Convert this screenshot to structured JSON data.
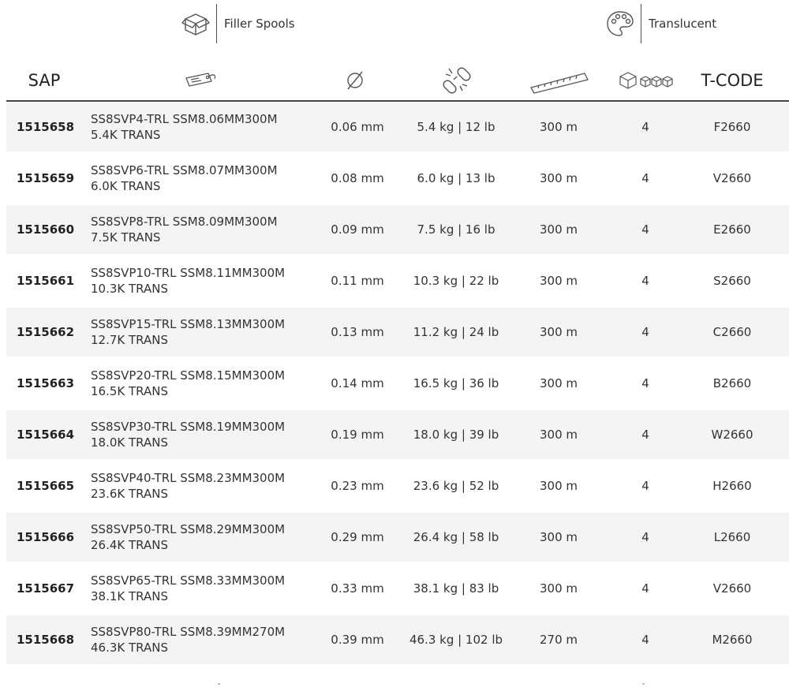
{
  "badges": {
    "filler": {
      "label": "Filler Spools",
      "icon": "box-icon"
    },
    "translucent": {
      "label": "Translucent",
      "icon": "palette-icon"
    }
  },
  "header": {
    "sap": "SAP",
    "description_icon": "tag-icon",
    "diameter_icon": "diameter-icon",
    "breaking_icon": "broken-chain-icon",
    "length_icon": "ruler-icon",
    "quantity_icon": "boxes-icon",
    "tcode": "T-CODE"
  },
  "rows": [
    {
      "sap": "1515658",
      "desc1": "SS8SVP4-TRL SSM8.06MM300M",
      "desc2": "5.4K TRANS",
      "diameter": "0.06 mm",
      "breaking": "5.4 kg | 12 lb",
      "length": "300 m",
      "qty": "4",
      "tcode": "F2660"
    },
    {
      "sap": "1515659",
      "desc1": "SS8SVP6-TRL SSM8.07MM300M",
      "desc2": "6.0K TRANS",
      "diameter": "0.08 mm",
      "breaking": "6.0 kg | 13 lb",
      "length": "300 m",
      "qty": "4",
      "tcode": "V2660"
    },
    {
      "sap": "1515660",
      "desc1": "SS8SVP8-TRL SSM8.09MM300M",
      "desc2": "7.5K TRANS",
      "diameter": "0.09 mm",
      "breaking": "7.5 kg | 16 lb",
      "length": "300 m",
      "qty": "4",
      "tcode": "E2660"
    },
    {
      "sap": "1515661",
      "desc1": "SS8SVP10-TRL SSM8.11MM300M",
      "desc2": "10.3K TRANS",
      "diameter": "0.11 mm",
      "breaking": "10.3 kg | 22 lb",
      "length": "300 m",
      "qty": "4",
      "tcode": "S2660"
    },
    {
      "sap": "1515662",
      "desc1": "SS8SVP15-TRL SSM8.13MM300M",
      "desc2": "12.7K TRANS",
      "diameter": "0.13 mm",
      "breaking": "11.2 kg | 24 lb",
      "length": "300 m",
      "qty": "4",
      "tcode": "C2660"
    },
    {
      "sap": "1515663",
      "desc1": "SS8SVP20-TRL SSM8.15MM300M",
      "desc2": "16.5K TRANS",
      "diameter": "0.14 mm",
      "breaking": "16.5 kg | 36 lb",
      "length": "300 m",
      "qty": "4",
      "tcode": "B2660"
    },
    {
      "sap": "1515664",
      "desc1": "SS8SVP30-TRL SSM8.19MM300M",
      "desc2": "18.0K TRANS",
      "diameter": "0.19 mm",
      "breaking": "18.0 kg | 39 lb",
      "length": "300 m",
      "qty": "4",
      "tcode": "W2660"
    },
    {
      "sap": "1515665",
      "desc1": "SS8SVP40-TRL SSM8.23MM300M",
      "desc2": "23.6K TRANS",
      "diameter": "0.23 mm",
      "breaking": "23.6 kg | 52 lb",
      "length": "300 m",
      "qty": "4",
      "tcode": "H2660"
    },
    {
      "sap": "1515666",
      "desc1": "SS8SVP50-TRL SSM8.29MM300M",
      "desc2": "26.4K TRANS",
      "diameter": "0.29 mm",
      "breaking": "26.4 kg | 58 lb",
      "length": "300 m",
      "qty": "4",
      "tcode": "L2660"
    },
    {
      "sap": "1515667",
      "desc1": "SS8SVP65-TRL SSM8.33MM300M",
      "desc2": "38.1K TRANS",
      "diameter": "0.33 mm",
      "breaking": "38.1 kg | 83 lb",
      "length": "300 m",
      "qty": "4",
      "tcode": "V2660"
    },
    {
      "sap": "1515668",
      "desc1": "SS8SVP80-TRL SSM8.39MM270M",
      "desc2": "46.3K TRANS",
      "diameter": "0.39 mm",
      "breaking": "46.3 kg | 102 lb",
      "length": "270 m",
      "qty": "4",
      "tcode": "M2660"
    }
  ]
}
